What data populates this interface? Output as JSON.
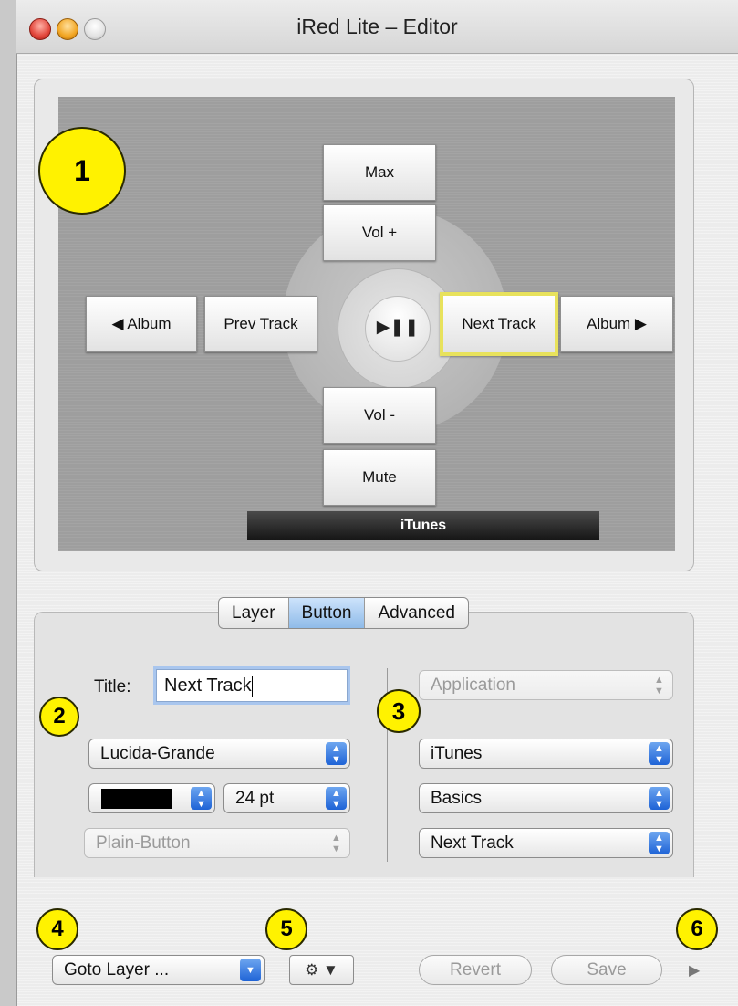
{
  "window": {
    "title": "iRed Lite – Editor"
  },
  "remote": {
    "buttons": {
      "max": "Max",
      "vol_up": "Vol +",
      "album_prev": "◀ Album",
      "prev_track": "Prev Track",
      "play_pause": "▶❚❚",
      "next_track": "Next Track",
      "album_next": "Album ▶",
      "vol_down": "Vol -",
      "mute": "Mute"
    },
    "footer_label": "iTunes"
  },
  "badges": {
    "b1": "1",
    "b2": "2",
    "b3": "3",
    "b4": "4",
    "b5": "5",
    "b6": "6"
  },
  "tabs": {
    "layer": "Layer",
    "button": "Button",
    "advanced": "Advanced",
    "active": "Button"
  },
  "button_tab": {
    "title_label": "Title:",
    "title_value": "Next Track",
    "font_popup": "Lucida-Grande",
    "color_value": "#000000",
    "size_popup": "24 pt",
    "style_popup": "Plain-Button",
    "category_popup": "Application",
    "app_popup": "iTunes",
    "group_popup": "Basics",
    "action_popup": "Next Track"
  },
  "bottom_bar": {
    "goto_popup": "Goto Layer ...",
    "gear_glyph": "⚙ ▼",
    "revert": "Revert",
    "save": "Save",
    "more_glyph": "▶"
  },
  "colors": {
    "accent_highlight": "#e8e25c",
    "badge": "#fff200",
    "tab_active": "#8fbbe9"
  }
}
